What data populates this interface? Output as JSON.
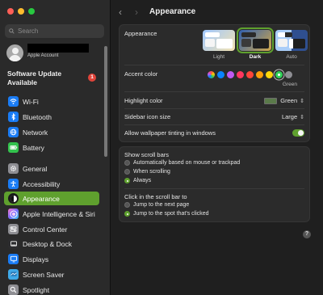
{
  "window": {
    "title": "Appearance"
  },
  "sidebar": {
    "search_placeholder": "Search",
    "account": {
      "subtitle": "Apple Account"
    },
    "update": {
      "title": "Software Update Available",
      "badge": "1"
    },
    "items": [
      {
        "label": "Wi-Fi",
        "icon": "wifi-icon",
        "color": "#1a7cf5"
      },
      {
        "label": "Bluetooth",
        "icon": "bluetooth-icon",
        "color": "#1a7cf5"
      },
      {
        "label": "Network",
        "icon": "network-icon",
        "color": "#1a7cf5"
      },
      {
        "label": "Battery",
        "icon": "battery-icon",
        "color": "#33c24d"
      },
      {
        "label": "General",
        "icon": "gear-icon",
        "color": "#8e8e93"
      },
      {
        "label": "Accessibility",
        "icon": "accessibility-icon",
        "color": "#1a7cf5"
      },
      {
        "label": "Appearance",
        "icon": "appearance-icon",
        "color": "#1c1c1c",
        "active": true
      },
      {
        "label": "Apple Intelligence & Siri",
        "icon": "siri-icon",
        "color": "#c75de0"
      },
      {
        "label": "Control Center",
        "icon": "control-center-icon",
        "color": "#8e8e93"
      },
      {
        "label": "Desktop & Dock",
        "icon": "dock-icon",
        "color": "#2c2c2e"
      },
      {
        "label": "Displays",
        "icon": "display-icon",
        "color": "#1a7cf5"
      },
      {
        "label": "Screen Saver",
        "icon": "screen-saver-icon",
        "color": "#3fa9e8"
      },
      {
        "label": "Spotlight",
        "icon": "spotlight-icon",
        "color": "#8e8e93"
      }
    ]
  },
  "main": {
    "title": "Appearance",
    "appearance": {
      "label": "Appearance",
      "options": [
        {
          "label": "Light",
          "selected": false
        },
        {
          "label": "Dark",
          "selected": true
        },
        {
          "label": "Auto",
          "selected": false
        }
      ]
    },
    "accent": {
      "label": "Accent color",
      "selected_name": "Green",
      "colors": [
        "multicolor",
        "#0a84ff",
        "#bf5af2",
        "#ff375f",
        "#ff453a",
        "#ff9f0a",
        "#ffd60a",
        "#30d158",
        "#8e8e93"
      ]
    },
    "highlight": {
      "label": "Highlight color",
      "value": "Green"
    },
    "sidebar_icon": {
      "label": "Sidebar icon size",
      "value": "Large"
    },
    "tinting": {
      "label": "Allow wallpaper tinting in windows",
      "on": true
    },
    "scroll_bars": {
      "label": "Show scroll bars",
      "options": [
        {
          "label": "Automatically based on mouse or trackpad",
          "selected": false
        },
        {
          "label": "When scrolling",
          "selected": false
        },
        {
          "label": "Always",
          "selected": true
        }
      ]
    },
    "click_scroll": {
      "label": "Click in the scroll bar to",
      "options": [
        {
          "label": "Jump to the next page",
          "selected": false
        },
        {
          "label": "Jump to the spot that's clicked",
          "selected": true
        }
      ]
    },
    "help": "?"
  }
}
